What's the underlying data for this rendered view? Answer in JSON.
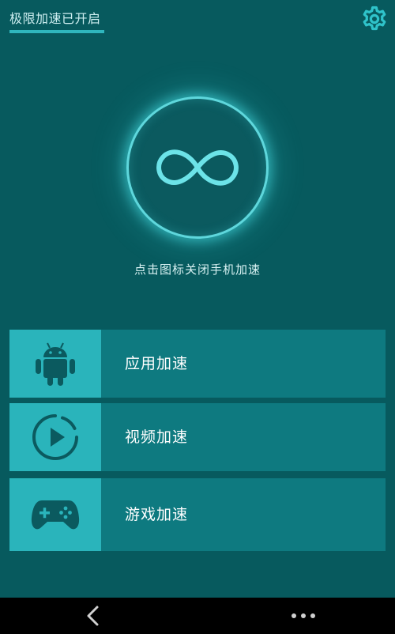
{
  "header": {
    "status_title": "极限加速已开启",
    "settings_icon": "gear-icon"
  },
  "boost": {
    "icon": "infinity-icon",
    "hint": "点击图标关闭手机加速"
  },
  "menu": [
    {
      "label": "应用加速",
      "icon": "android-icon"
    },
    {
      "label": "视频加速",
      "icon": "play-circle-icon"
    },
    {
      "label": "游戏加速",
      "icon": "gamepad-icon"
    }
  ],
  "navbar": {
    "back_icon": "back-chevron-icon",
    "more_icon": "more-dots-icon"
  },
  "colors": {
    "background": "#075a5e",
    "accent": "#2ab4bb",
    "row": "#0e7a80",
    "glow": "#5ed7dc"
  }
}
